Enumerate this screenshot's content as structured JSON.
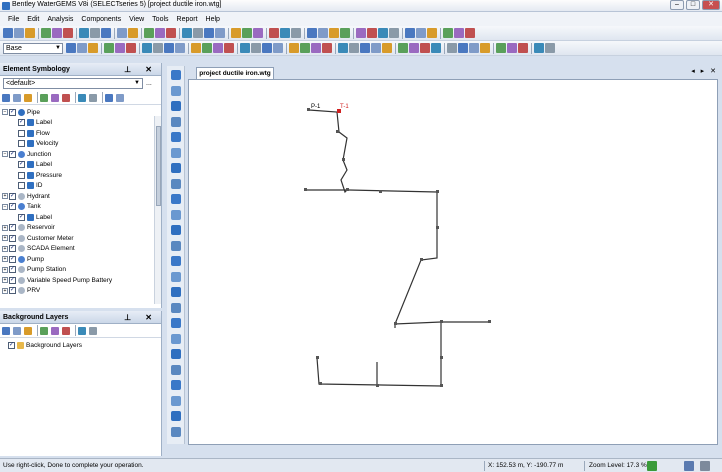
{
  "window": {
    "title": "Bentley WaterGEMS V8i (SELECTseries 5) [project ductile iron.wtg]",
    "minimize": "–",
    "maximize": "□",
    "close": "✕"
  },
  "menu": [
    "File",
    "Edit",
    "Analysis",
    "Components",
    "View",
    "Tools",
    "Report",
    "Help"
  ],
  "toolbar": {
    "scenario": "Base"
  },
  "element_symbology": {
    "title": "Element Symbology",
    "pane_buttons": "⊥ ✕",
    "combo": "<default>",
    "more": "...",
    "items": [
      {
        "label": "Pipe",
        "level": 0,
        "expander": "−",
        "checked": true,
        "icon": "pipe-icon"
      },
      {
        "label": "Label",
        "level": 1,
        "checked": true,
        "icon": "label-icon"
      },
      {
        "label": "Flow",
        "level": 1,
        "checked": false,
        "icon": "flow-icon"
      },
      {
        "label": "Velocity",
        "level": 1,
        "checked": false,
        "icon": "velocity-icon"
      },
      {
        "label": "Junction",
        "level": 0,
        "expander": "−",
        "checked": true,
        "icon": "junction-icon"
      },
      {
        "label": "Label",
        "level": 1,
        "checked": true,
        "icon": "label-icon"
      },
      {
        "label": "Pressure",
        "level": 1,
        "checked": false,
        "icon": "pressure-icon"
      },
      {
        "label": "ID",
        "level": 1,
        "checked": false,
        "icon": "id-icon"
      },
      {
        "label": "Hydrant",
        "level": 0,
        "expander": "+",
        "checked": true,
        "icon": "hydrant-icon"
      },
      {
        "label": "Tank",
        "level": 0,
        "expander": "−",
        "checked": true,
        "icon": "tank-icon"
      },
      {
        "label": "Label",
        "level": 1,
        "checked": true,
        "icon": "label-icon"
      },
      {
        "label": "Reservoir",
        "level": 0,
        "expander": "+",
        "checked": true,
        "icon": "reservoir-icon"
      },
      {
        "label": "Customer Meter",
        "level": 0,
        "expander": "+",
        "checked": true,
        "icon": "customer-meter-icon"
      },
      {
        "label": "SCADA Element",
        "level": 0,
        "expander": "+",
        "checked": true,
        "icon": "scada-icon"
      },
      {
        "label": "Pump",
        "level": 0,
        "expander": "+",
        "checked": true,
        "icon": "pump-icon"
      },
      {
        "label": "Pump Station",
        "level": 0,
        "expander": "+",
        "checked": true,
        "icon": "pump-station-icon"
      },
      {
        "label": "Variable Speed Pump Battery",
        "level": 0,
        "expander": "+",
        "checked": true,
        "icon": "vspb-icon"
      },
      {
        "label": "PRV",
        "level": 0,
        "expander": "+",
        "checked": true,
        "icon": "prv-icon"
      }
    ]
  },
  "background_layers": {
    "title": "Background Layers",
    "pane_buttons": "⊥ ✕",
    "items": [
      {
        "label": "Background Layers",
        "checked": true,
        "icon": "folder-icon"
      }
    ]
  },
  "document": {
    "tab": "project ductile iron.wtg",
    "tab_nav": "◂ ▸ ✕",
    "labels": {
      "pipe": "P-1",
      "tank": "T-1"
    }
  },
  "status": {
    "hint": "Use right-click, Done to complete your operation.",
    "coords": "X: 152.53 m, Y: -190.77 m",
    "zoom": "Zoom Level: 17.3 %"
  },
  "colors": {
    "accent": "#2f6fc0",
    "tank_label": "#d02020",
    "pipe": "#333333",
    "panel_header": "#cbd7e8"
  }
}
